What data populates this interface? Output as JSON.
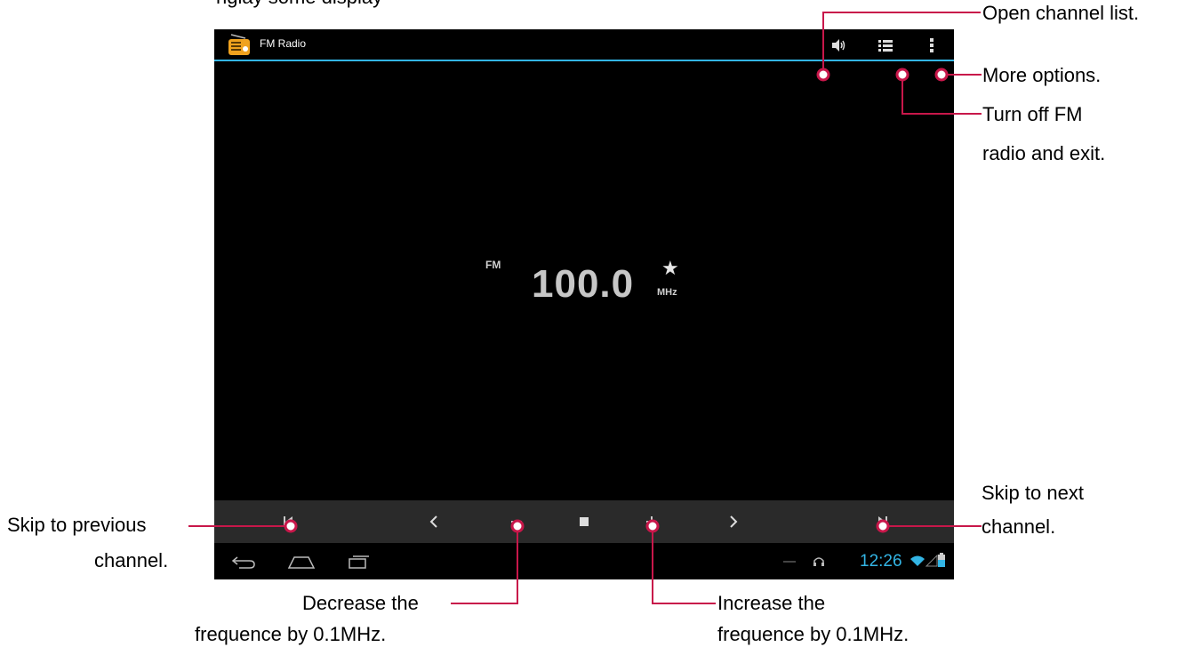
{
  "top_caption": "nglay some display",
  "app": {
    "title": "FM Radio",
    "accent": "#33b5e5",
    "icons": [
      "radio-app-icon",
      "speaker-icon",
      "list-icon",
      "overflow-menu-icon"
    ]
  },
  "tuner": {
    "band": "FM",
    "frequency": "100.0",
    "unit": "MHz",
    "favorite_icon": "star-icon"
  },
  "controls": [
    "prev-channel-icon",
    "decrease-icon",
    "stop-icon",
    "increase-icon",
    "next-channel-icon"
  ],
  "status": {
    "time": "12:26",
    "icons": [
      "headset-icon",
      "wifi-icon",
      "signal-icon",
      "battery-icon"
    ]
  },
  "nav": [
    "back-icon",
    "home-icon",
    "recent-apps-icon"
  ],
  "callouts": {
    "open_channel_list": "Open channel list.",
    "more_options": "More options.",
    "turn_off": [
      "Turn off FM",
      "radio and exit."
    ],
    "skip_previous": [
      "Skip to previous",
      "channel."
    ],
    "skip_next": [
      "Skip to next",
      "channel."
    ],
    "decrease": [
      "Decrease the",
      "frequence by 0.1MHz."
    ],
    "increase": [
      "Increase the",
      "frequence by 0.1MHz."
    ]
  },
  "colors": {
    "callout_line": "#c8174a",
    "screen": "#000000",
    "control_bar": "#2a2a2a"
  }
}
